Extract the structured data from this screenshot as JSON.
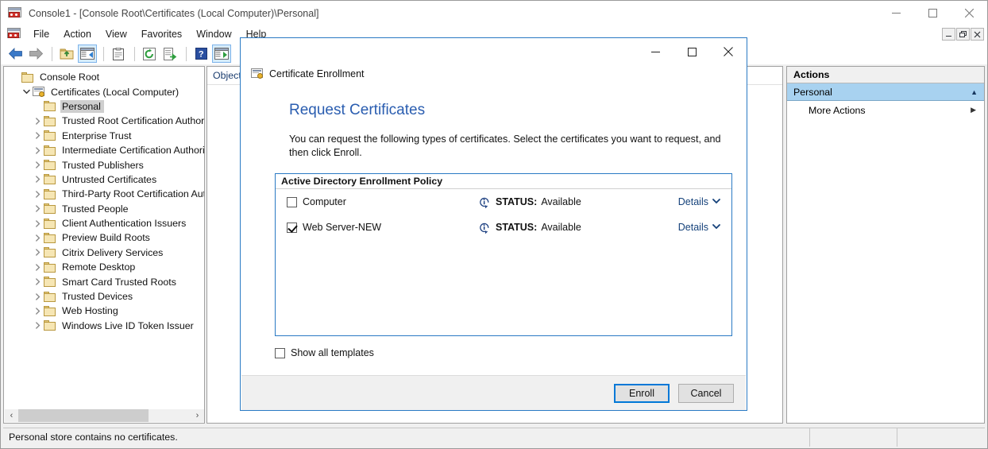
{
  "window": {
    "title": "Console1 - [Console Root\\Certificates (Local Computer)\\Personal]",
    "icon": "mmc-console-icon",
    "controls": {
      "minimize": "minimize-icon",
      "maximize": "maximize-icon",
      "close": "close-icon"
    }
  },
  "menubar": {
    "items": [
      {
        "label": "File"
      },
      {
        "label": "Action"
      },
      {
        "label": "View"
      },
      {
        "label": "Favorites"
      },
      {
        "label": "Window"
      },
      {
        "label": "Help"
      }
    ],
    "mdi_controls": {
      "minimize": "_",
      "restore": "❐",
      "close": "✕"
    }
  },
  "toolbar": {
    "items": [
      {
        "name": "back-icon",
        "checked": false
      },
      {
        "name": "forward-icon",
        "checked": false
      },
      {
        "name": "up-folder-icon",
        "checked": false
      },
      {
        "name": "show-hide-tree-icon",
        "checked": true
      },
      {
        "name": "properties-icon",
        "checked": false
      },
      {
        "name": "refresh-icon",
        "checked": false
      },
      {
        "name": "export-list-icon",
        "checked": false
      },
      {
        "name": "help-icon",
        "checked": false
      },
      {
        "name": "show-action-pane-icon",
        "checked": true
      }
    ]
  },
  "tree": {
    "nodes": [
      {
        "label": "Console Root",
        "indent": 0,
        "twisty": "",
        "icon": "folder-icon",
        "selected": false
      },
      {
        "label": "Certificates (Local Computer)",
        "indent": 1,
        "twisty": "expanded",
        "icon": "certificate-store-icon",
        "selected": false
      },
      {
        "label": "Personal",
        "indent": 2,
        "twisty": "",
        "icon": "folder-icon",
        "selected": true
      },
      {
        "label": "Trusted Root Certification Authorit",
        "indent": 2,
        "twisty": "collapsed",
        "icon": "folder-icon",
        "selected": false
      },
      {
        "label": "Enterprise Trust",
        "indent": 2,
        "twisty": "collapsed",
        "icon": "folder-icon",
        "selected": false
      },
      {
        "label": "Intermediate Certification Authorit",
        "indent": 2,
        "twisty": "collapsed",
        "icon": "folder-icon",
        "selected": false
      },
      {
        "label": "Trusted Publishers",
        "indent": 2,
        "twisty": "collapsed",
        "icon": "folder-icon",
        "selected": false
      },
      {
        "label": "Untrusted Certificates",
        "indent": 2,
        "twisty": "collapsed",
        "icon": "folder-icon",
        "selected": false
      },
      {
        "label": "Third-Party Root Certification Auth",
        "indent": 2,
        "twisty": "collapsed",
        "icon": "folder-icon",
        "selected": false
      },
      {
        "label": "Trusted People",
        "indent": 2,
        "twisty": "collapsed",
        "icon": "folder-icon",
        "selected": false
      },
      {
        "label": "Client Authentication Issuers",
        "indent": 2,
        "twisty": "collapsed",
        "icon": "folder-icon",
        "selected": false
      },
      {
        "label": "Preview Build Roots",
        "indent": 2,
        "twisty": "collapsed",
        "icon": "folder-icon",
        "selected": false
      },
      {
        "label": "Citrix Delivery Services",
        "indent": 2,
        "twisty": "collapsed",
        "icon": "folder-icon",
        "selected": false
      },
      {
        "label": "Remote Desktop",
        "indent": 2,
        "twisty": "collapsed",
        "icon": "folder-icon",
        "selected": false
      },
      {
        "label": "Smart Card Trusted Roots",
        "indent": 2,
        "twisty": "collapsed",
        "icon": "folder-icon",
        "selected": false
      },
      {
        "label": "Trusted Devices",
        "indent": 2,
        "twisty": "collapsed",
        "icon": "folder-icon",
        "selected": false
      },
      {
        "label": "Web Hosting",
        "indent": 2,
        "twisty": "collapsed",
        "icon": "folder-icon",
        "selected": false
      },
      {
        "label": "Windows Live ID Token Issuer",
        "indent": 2,
        "twisty": "collapsed",
        "icon": "folder-icon",
        "selected": false
      }
    ],
    "hscroll": {
      "left_arrow": "‹",
      "right_arrow": "›"
    }
  },
  "list_pane": {
    "columns": [
      {
        "label": "Object"
      }
    ]
  },
  "actions_pane": {
    "title": "Actions",
    "group": {
      "label": "Personal",
      "collapse_icon": "chevron-up-icon"
    },
    "items": [
      {
        "label": "More Actions",
        "submenu_icon": "triangle-right-icon"
      }
    ]
  },
  "statusbar": {
    "message": "Personal store contains no certificates.",
    "cell2": "",
    "cell3": ""
  },
  "dialog": {
    "app_name": "Certificate Enrollment",
    "app_icon": "certificate-enrollment-icon",
    "controls": {
      "minimize": "minimize-icon",
      "maximize": "maximize-icon",
      "close": "close-icon"
    },
    "heading": "Request Certificates",
    "description": "You can request the following types of certificates. Select the certificates you want to request, and then click Enroll.",
    "policy_box": {
      "header": "Active Directory Enrollment Policy",
      "rows": [
        {
          "name": "Computer",
          "checked": false,
          "status_label": "STATUS:",
          "status_value": "Available",
          "info_icon": "info-icon",
          "details_label": "Details",
          "details_icon": "chevron-down-icon"
        },
        {
          "name": "Web Server-NEW",
          "checked": true,
          "status_label": "STATUS:",
          "status_value": "Available",
          "info_icon": "info-icon",
          "details_label": "Details",
          "details_icon": "chevron-down-icon"
        }
      ]
    },
    "show_all_templates": {
      "label": "Show all templates",
      "checked": false
    },
    "buttons": {
      "enroll": "Enroll",
      "cancel": "Cancel"
    }
  },
  "colors": {
    "heading_blue": "#2a5db0",
    "link_blue": "#14417a",
    "dialog_border": "#2a7ac4",
    "accent_button": "#0078d7",
    "selection_blue": "#a8d2f0",
    "tree_selection": "#cfcfcf"
  }
}
